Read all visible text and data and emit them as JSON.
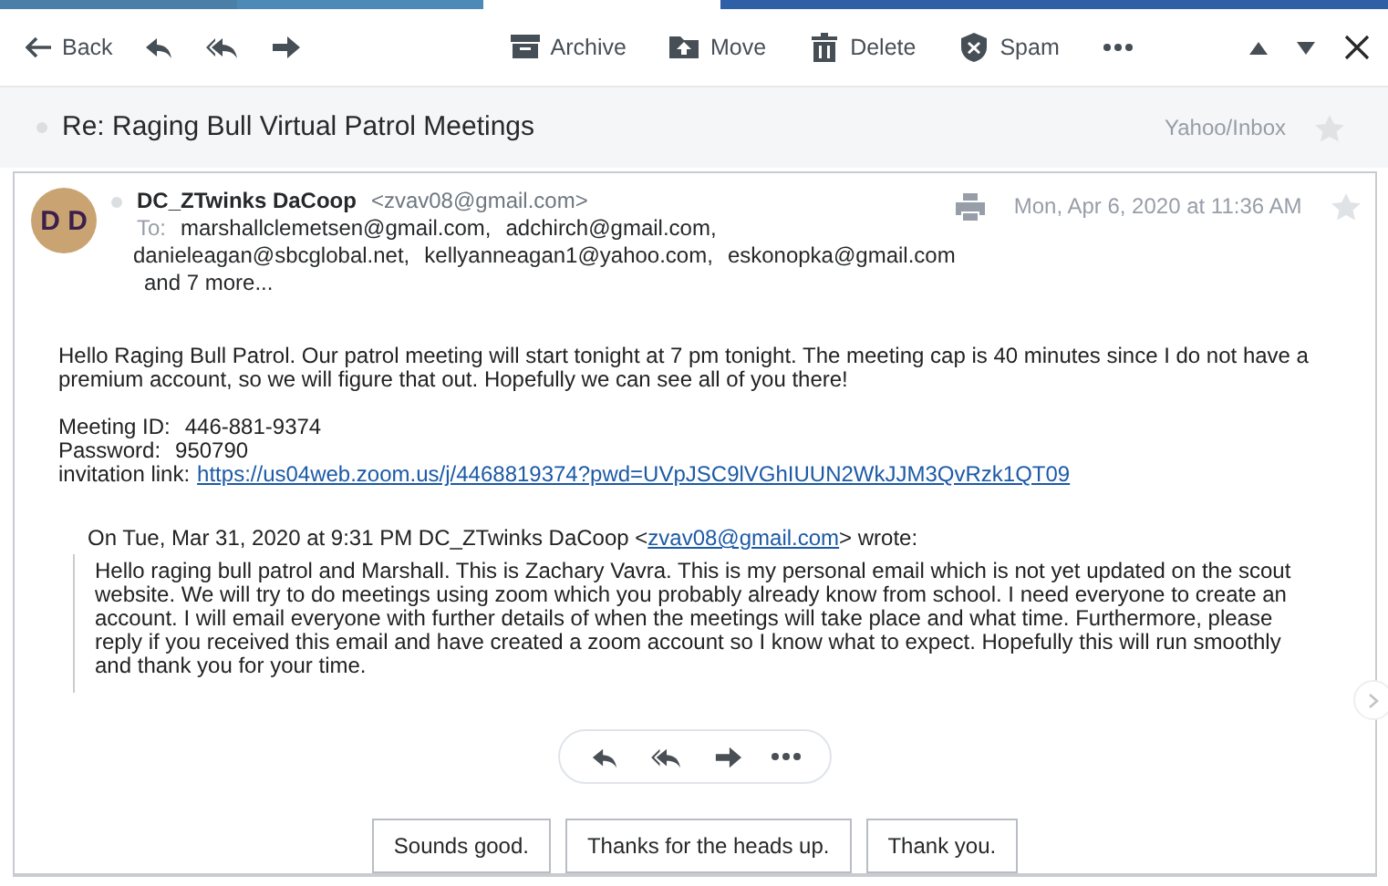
{
  "toolbar": {
    "back": "Back",
    "actions": [
      {
        "kind": "archive",
        "label": "Archive"
      },
      {
        "kind": "move",
        "label": "Move"
      },
      {
        "kind": "delete",
        "label": "Delete"
      },
      {
        "kind": "spam",
        "label": "Spam"
      }
    ]
  },
  "subject": {
    "text": "Re: Raging Bull Virtual Patrol Meetings",
    "folder": "Yahoo/Inbox",
    "starred": false
  },
  "message": {
    "avatar": "D D",
    "sender_name": "DC_ZTwinks DaCoop",
    "sender_email": "<zvav08@gmail.com>",
    "to_label": "To:",
    "recipient_lines": [
      [
        "marshallclemetsen@gmail.com,",
        "adchirch@gmail.com,"
      ],
      [
        "danieleagan@sbcglobal.net,",
        "kellyanneagan1@yahoo.com,",
        "eskonopka@gmail.com"
      ]
    ],
    "more": "and 7 more...",
    "date": "Mon, Apr 6, 2020 at 11:36 AM",
    "starred": false,
    "greeting": "Hello Raging Bull Patrol. Our patrol meeting will start tonight at 7 pm tonight. The meeting cap is 40 minutes since I do not have a premium account, so we will figure that out. Hopefully we can see all of you there!",
    "details": [
      {
        "label": "Meeting ID:",
        "value": "446-881-9374"
      },
      {
        "label": "Password:",
        "value": "950790"
      },
      {
        "label": "invitation link:",
        "link": "https://us04web.zoom.us/j/4468819374?pwd=UVpJSC9lVGhIUUN2WkJJM3QvRzk1QT09"
      }
    ],
    "quote": {
      "intro_before": "On Tue, Mar 31, 2020 at 9:31 PM DC_ZTwinks DaCoop <",
      "intro_link": "zvav08@gmail.com",
      "intro_after": "> wrote:",
      "text": "Hello raging bull patrol and Marshall. This is Zachary Vavra. This is my personal email which is not yet updated on the scout website. We will try to do meetings using zoom which you probably already know from school. I need everyone to create an account. I will email everyone with further details of when the meetings will take place and what time. Furthermore, please reply if you received this email and have created a zoom account so I know what to expect. Hopefully this will run smoothly and thank you for your time."
    }
  },
  "quick_replies": [
    "Sounds good.",
    "Thanks for the heads up.",
    "Thank you."
  ]
}
